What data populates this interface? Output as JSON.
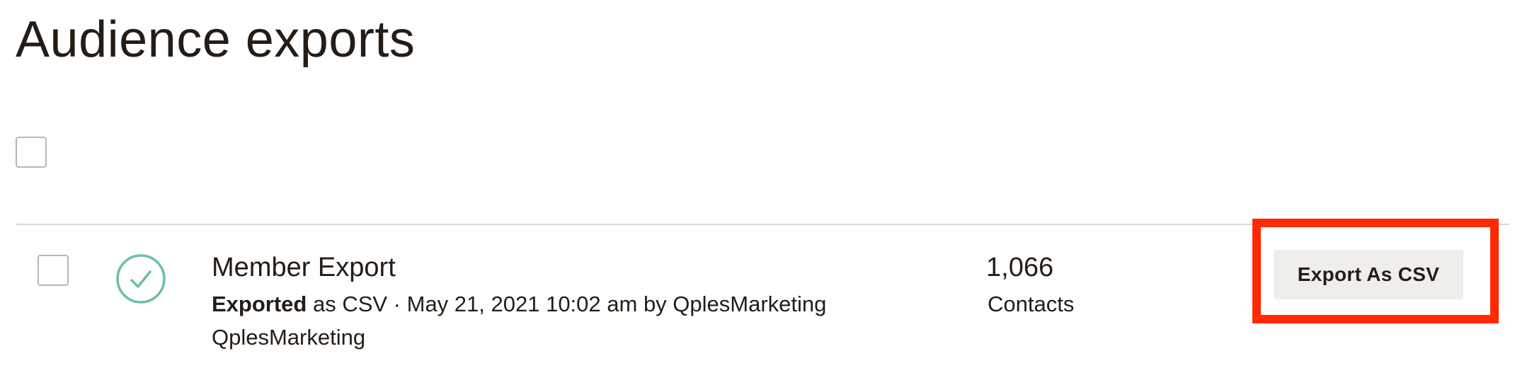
{
  "page": {
    "title": "Audience exports"
  },
  "exports": [
    {
      "name": "Member Export",
      "status_icon": "check-circle-icon",
      "status_word": "Exported",
      "format_text": " as CSV · May 21, 2021 10:02 am by QplesMarketing QplesMarketing",
      "count": "1,066",
      "count_label": "Contacts",
      "action_label": "Export As CSV"
    }
  ],
  "colors": {
    "text": "#241c15",
    "success": "#6bbfa7",
    "button_bg": "#efeeea",
    "highlight": "#ff2a00",
    "divider": "#d9d9d6"
  }
}
